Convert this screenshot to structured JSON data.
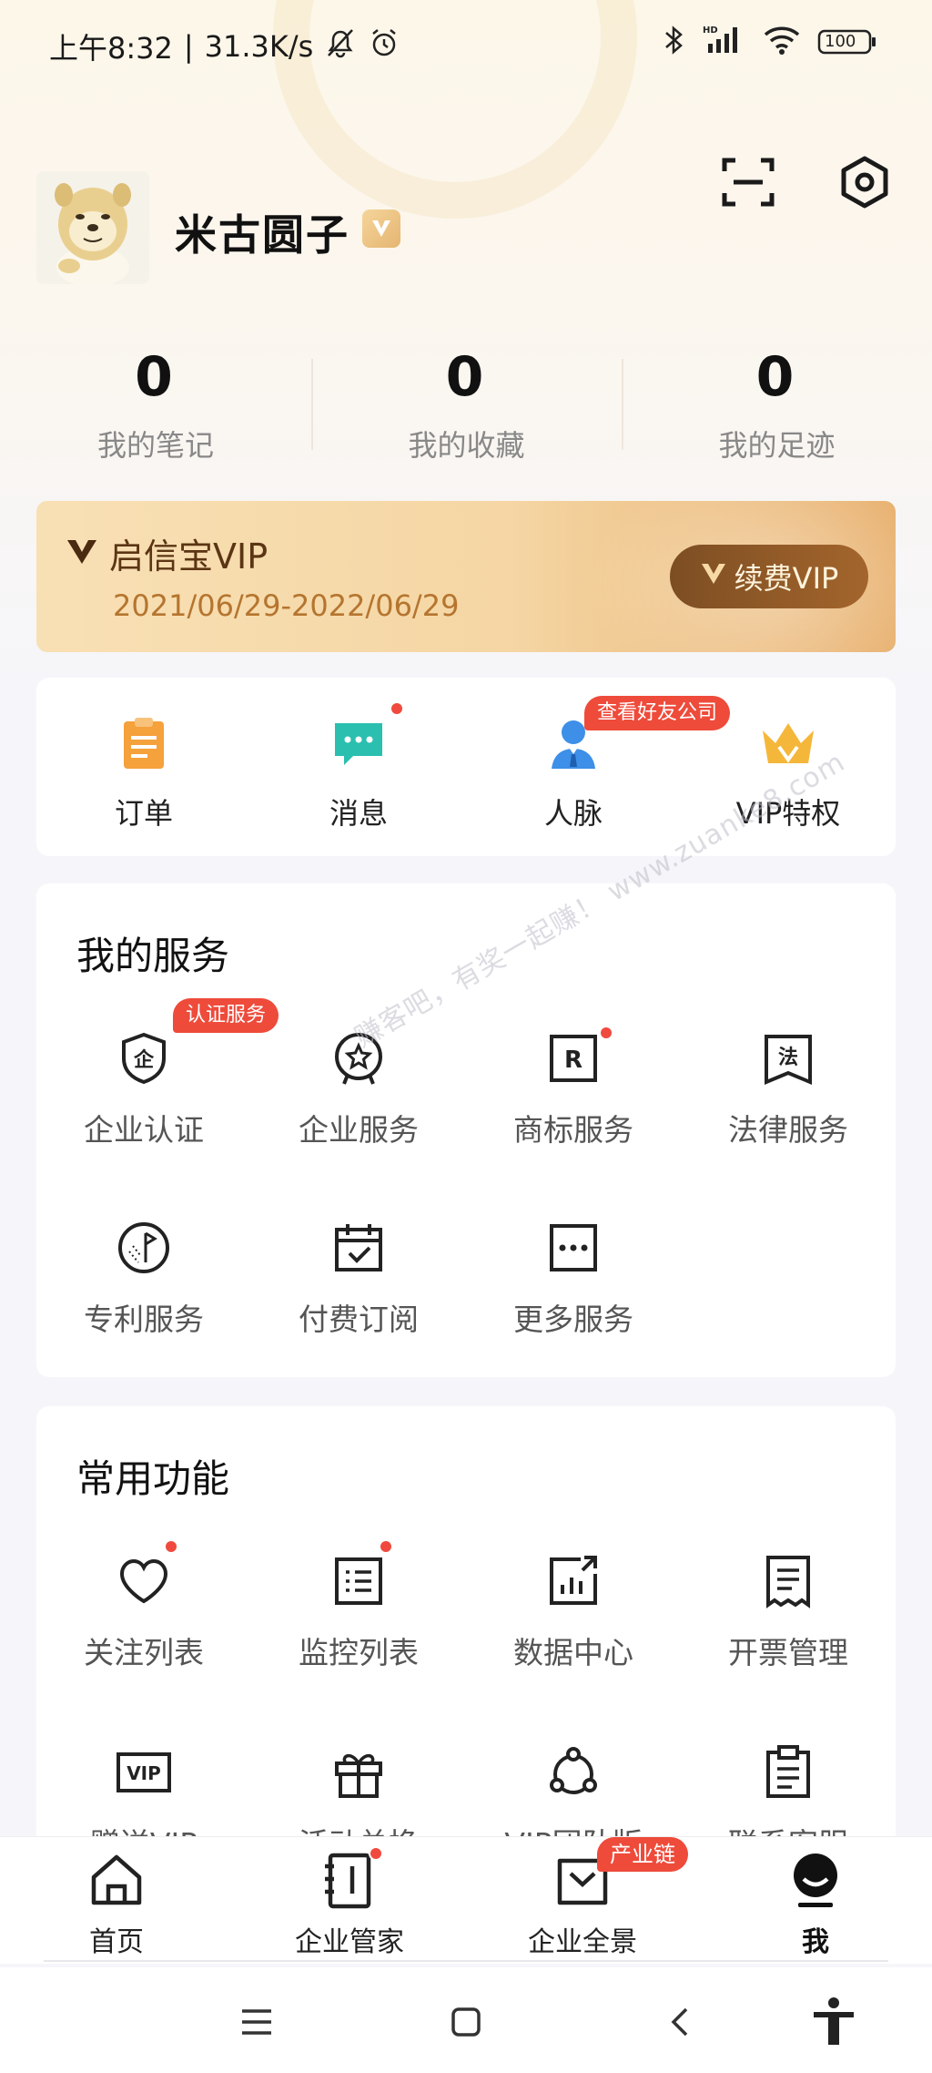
{
  "status_bar": {
    "time": "上午8:32",
    "network_speed": "31.3K/s",
    "battery": "100"
  },
  "profile": {
    "username": "米古圆子"
  },
  "stats": [
    {
      "value": "0",
      "label": "我的笔记"
    },
    {
      "value": "0",
      "label": "我的收藏"
    },
    {
      "value": "0",
      "label": "我的足迹"
    }
  ],
  "vip_card": {
    "title": "启信宝VIP",
    "date_range": "2021/06/29-2022/06/29",
    "renew_label": "续费VIP"
  },
  "quick_actions": [
    {
      "label": "订单",
      "icon": "order-icon"
    },
    {
      "label": "消息",
      "icon": "message-icon"
    },
    {
      "label": "人脉",
      "icon": "contacts-icon",
      "badge": "查看好友公司"
    },
    {
      "label": "VIP特权",
      "icon": "crown-icon"
    }
  ],
  "my_services": {
    "title": "我的服务",
    "items": [
      {
        "label": "企业认证",
        "icon": "shield-icon",
        "badge": "认证服务"
      },
      {
        "label": "企业服务",
        "icon": "star-badge-icon"
      },
      {
        "label": "商标服务",
        "icon": "trademark-icon"
      },
      {
        "label": "法律服务",
        "icon": "law-icon"
      },
      {
        "label": "专利服务",
        "icon": "patent-icon"
      },
      {
        "label": "付费订阅",
        "icon": "calendar-check-icon"
      },
      {
        "label": "更多服务",
        "icon": "more-icon"
      }
    ]
  },
  "common_functions": {
    "title": "常用功能",
    "items": [
      {
        "label": "关注列表",
        "icon": "heart-icon"
      },
      {
        "label": "监控列表",
        "icon": "monitor-list-icon"
      },
      {
        "label": "数据中心",
        "icon": "data-center-icon"
      },
      {
        "label": "开票管理",
        "icon": "invoice-icon"
      },
      {
        "label": "赠送VIP",
        "icon": "vip-gift-icon"
      },
      {
        "label": "活动兑换",
        "icon": "gift-icon"
      },
      {
        "label": "VIP团队版",
        "icon": "team-icon"
      },
      {
        "label": "联系客服",
        "icon": "clipboard-icon"
      }
    ]
  },
  "watermark": "赚客吧，有奖一起赚！ www.zuanke8.com",
  "bottom_nav": [
    {
      "label": "首页",
      "icon": "home-icon"
    },
    {
      "label": "企业管家",
      "icon": "notebook-icon"
    },
    {
      "label": "企业全景",
      "icon": "bag-icon",
      "badge": "产业链"
    },
    {
      "label": "我",
      "icon": "me-icon"
    }
  ],
  "colors": {
    "accent_gold": "#e7ae6a",
    "vip_brown": "#7d4e23",
    "badge_red": "#ee4b3b",
    "icon_orange": "#f5a13c",
    "icon_teal": "#2bbfb0",
    "icon_blue": "#3d8fe8"
  }
}
